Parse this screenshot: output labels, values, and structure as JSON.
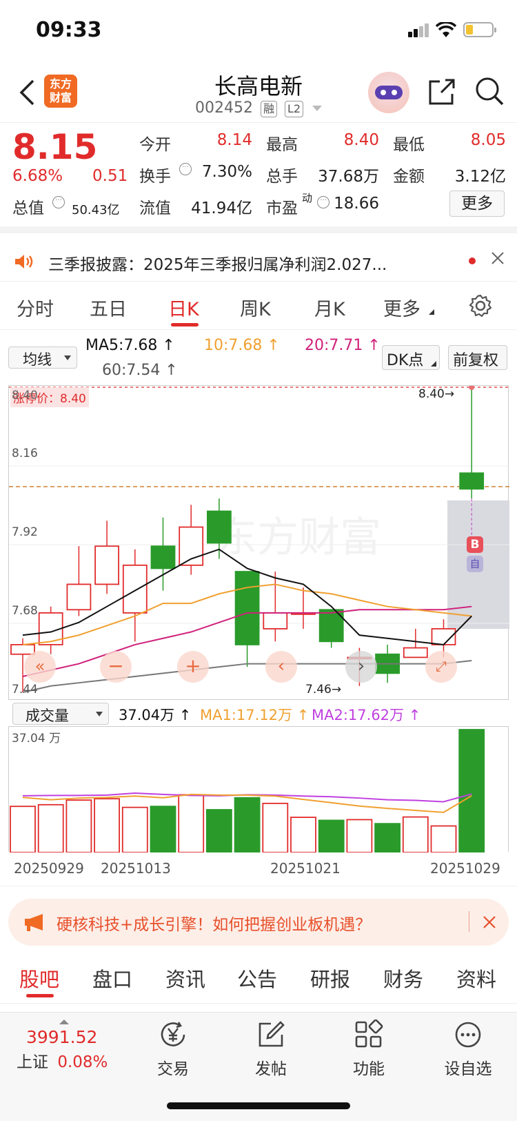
{
  "status": {
    "time": "09:33"
  },
  "header": {
    "name": "长高电新",
    "code": "002452",
    "tag1": "融",
    "tag2": "L2",
    "logo_line1": "东方",
    "logo_line2": "财富"
  },
  "quote": {
    "price": "8.15",
    "change_pct": "6.68%",
    "change": "0.51",
    "total_cap_label": "总值",
    "total_cap": "50.43亿",
    "open_label": "今开",
    "open": "8.14",
    "high_label": "最高",
    "high": "8.40",
    "low_label": "最低",
    "low": "8.05",
    "turnover_label": "换手",
    "turnover": "7.30%",
    "volume_label": "总手",
    "volume": "37.68万",
    "amount_label": "金额",
    "amount": "3.12亿",
    "float_cap_label": "流值",
    "float_cap": "41.94亿",
    "pe_label": "市盈",
    "pe_sup": "动",
    "pe": "18.66",
    "more_button": "更多"
  },
  "notice": {
    "text": "三季报披露：2025年三季报归属净利润2.027..."
  },
  "period_tabs": [
    {
      "label": "分时",
      "active": false
    },
    {
      "label": "五日",
      "active": false
    },
    {
      "label": "日K",
      "active": true
    },
    {
      "label": "周K",
      "active": false
    },
    {
      "label": "月K",
      "active": false
    },
    {
      "label": "更多",
      "active": false
    }
  ],
  "ma_bar": {
    "selector": "均线",
    "ma5": "MA5:7.68",
    "ma10": "10:7.68",
    "ma20": "20:7.71",
    "ma60": "60:7.54",
    "dk_button": "DK点",
    "adjust_button": "前复权"
  },
  "kline_labels": {
    "limit_price": "涨停价：8.40",
    "y_top": "8.40",
    "y1": "8.16",
    "y2": "7.92",
    "y3": "7.68",
    "y4": "7.44",
    "high_marker": "8.40",
    "low_marker": "7.46",
    "buy_badge": "B",
    "self_badge": "自"
  },
  "volume_bar": {
    "selector": "成交量",
    "vol": "37.04万",
    "ma1": "MA1:17.12万",
    "ma2": "MA2:17.62万",
    "y_max": "37.04 万"
  },
  "dates": [
    "20250929",
    "20251013",
    "20251021",
    "20251029"
  ],
  "chart_data": {
    "type": "candlestick",
    "y_range": [
      7.44,
      8.4
    ],
    "candles": [
      {
        "o": 7.56,
        "c": 7.59,
        "h": 7.61,
        "l": 7.44
      },
      {
        "o": 7.59,
        "c": 7.69,
        "h": 7.71,
        "l": 7.56
      },
      {
        "o": 7.7,
        "c": 7.78,
        "h": 7.9,
        "l": 7.68
      },
      {
        "o": 7.78,
        "c": 7.9,
        "h": 7.98,
        "l": 7.75
      },
      {
        "o": 7.69,
        "c": 7.84,
        "h": 7.89,
        "l": 7.6
      },
      {
        "o": 7.9,
        "c": 7.83,
        "h": 7.99,
        "l": 7.76
      },
      {
        "o": 7.84,
        "c": 7.96,
        "h": 8.03,
        "l": 7.81
      },
      {
        "o": 8.01,
        "c": 7.91,
        "h": 8.05,
        "l": 7.86
      },
      {
        "o": 7.82,
        "c": 7.59,
        "h": 7.82,
        "l": 7.52
      },
      {
        "o": 7.64,
        "c": 7.69,
        "h": 7.82,
        "l": 7.6
      },
      {
        "o": 7.69,
        "c": 7.69,
        "h": 7.77,
        "l": 7.64
      },
      {
        "o": 7.7,
        "c": 7.6,
        "h": 7.7,
        "l": 7.58
      },
      {
        "o": 7.55,
        "c": 7.55,
        "h": 7.58,
        "l": 7.46
      },
      {
        "o": 7.56,
        "c": 7.5,
        "h": 7.59,
        "l": 7.47
      },
      {
        "o": 7.55,
        "c": 7.58,
        "h": 7.64,
        "l": 7.55
      },
      {
        "o": 7.59,
        "c": 7.64,
        "h": 7.67,
        "l": 7.55
      },
      {
        "o": 8.13,
        "c": 8.08,
        "h": 8.4,
        "l": 8.05
      }
    ],
    "ma5": [
      7.62,
      7.63,
      7.66,
      7.71,
      7.76,
      7.81,
      7.86,
      7.89,
      7.83,
      7.8,
      7.78,
      7.71,
      7.62,
      7.61,
      7.6,
      7.59,
      7.68
    ],
    "ma10": [
      7.59,
      7.6,
      7.62,
      7.65,
      7.68,
      7.72,
      7.72,
      7.75,
      7.77,
      7.78,
      7.76,
      7.75,
      7.73,
      7.71,
      7.7,
      7.69,
      7.68
    ],
    "ma20": [
      7.49,
      7.51,
      7.53,
      7.56,
      7.59,
      7.61,
      7.63,
      7.66,
      7.69,
      7.69,
      7.69,
      7.69,
      7.7,
      7.7,
      7.7,
      7.7,
      7.71
    ],
    "ma60": [
      7.44,
      7.46,
      7.47,
      7.48,
      7.49,
      7.5,
      7.51,
      7.52,
      7.53,
      7.53,
      7.53,
      7.53,
      7.53,
      7.53,
      7.53,
      7.53,
      7.54
    ],
    "volumes": [
      13.9,
      14.4,
      15.8,
      16.2,
      13.6,
      13.9,
      17.4,
      12.9,
      16.5,
      14.8,
      10.6,
      9.7,
      9.9,
      8.7,
      10.7,
      8.0,
      37.04
    ],
    "vol_ma1": [
      16.6,
      15.9,
      16.4,
      16.6,
      17.0,
      16.5,
      17.5,
      17.3,
      17.3,
      17.0,
      16.0,
      15.0,
      14.0,
      13.3,
      12.7,
      12.1,
      17.12
    ],
    "vol_ma2": [
      17.1,
      17.2,
      17.2,
      17.3,
      17.9,
      17.5,
      17.2,
      17.1,
      17.4,
      17.3,
      17.0,
      16.8,
      16.4,
      15.9,
      15.7,
      15.3,
      17.62
    ]
  },
  "ad": {
    "text": "硬核科技+成长引擎！如何把握创业板机遇？"
  },
  "content_tabs": [
    {
      "label": "股吧",
      "active": true
    },
    {
      "label": "盘口",
      "active": false
    },
    {
      "label": "资讯",
      "active": false
    },
    {
      "label": "公告",
      "active": false
    },
    {
      "label": "研报",
      "active": false
    },
    {
      "label": "财务",
      "active": false
    },
    {
      "label": "资料",
      "active": false
    }
  ],
  "bottom_nav": {
    "index_value": "3991.52",
    "index_name": "上证",
    "index_change": "0.08%",
    "items": [
      {
        "label": "交易"
      },
      {
        "label": "发帖"
      },
      {
        "label": "功能"
      },
      {
        "label": "设自选"
      }
    ]
  },
  "colors": {
    "up": "#e12b2b",
    "down": "#2a9b2a",
    "ma5": "#111111",
    "ma10": "#f0a030",
    "ma20": "#d0207a",
    "ma60": "#777777",
    "vma2": "#c040e0"
  }
}
